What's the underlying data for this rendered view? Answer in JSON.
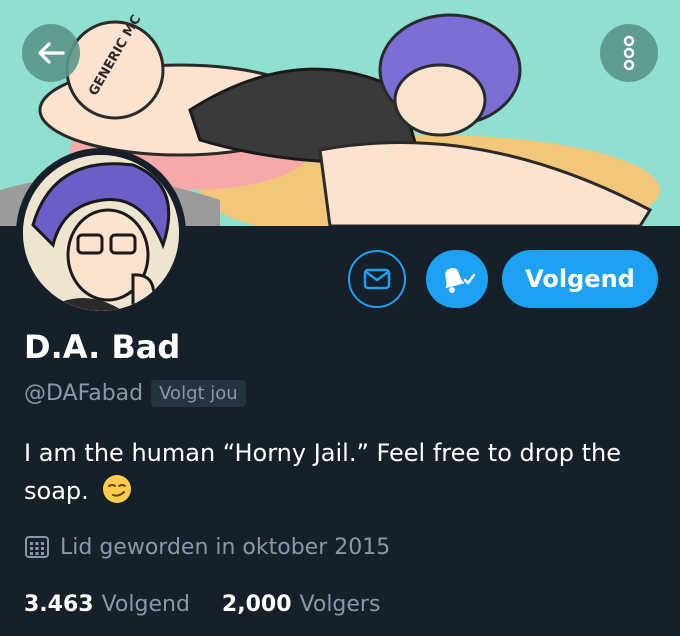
{
  "profile": {
    "name": "D.A. Bad",
    "handle": "@DAFabad",
    "follows_you": "Volgt jou",
    "bio": "I am the human “Horny Jail.” Feel free to drop the soap.",
    "joined": "Lid geworden in oktober 2015",
    "banner_text": "GENERIC MC"
  },
  "actions": {
    "follow_label": "Volgend"
  },
  "stats": {
    "following_count": "3.463",
    "following_label": "Volgend",
    "followers_count": "2,000",
    "followers_label": "Volgers"
  },
  "icons": {
    "back": "arrow-left-icon",
    "more": "more-vertical-icon",
    "message": "envelope-icon",
    "notifications": "bell-check-icon",
    "calendar": "calendar-icon",
    "emoji": "smirk-emoji"
  },
  "colors": {
    "background": "#15202b",
    "accent": "#1da1f2",
    "secondary_text": "#8899a6",
    "banner": "#8fe0d0"
  }
}
